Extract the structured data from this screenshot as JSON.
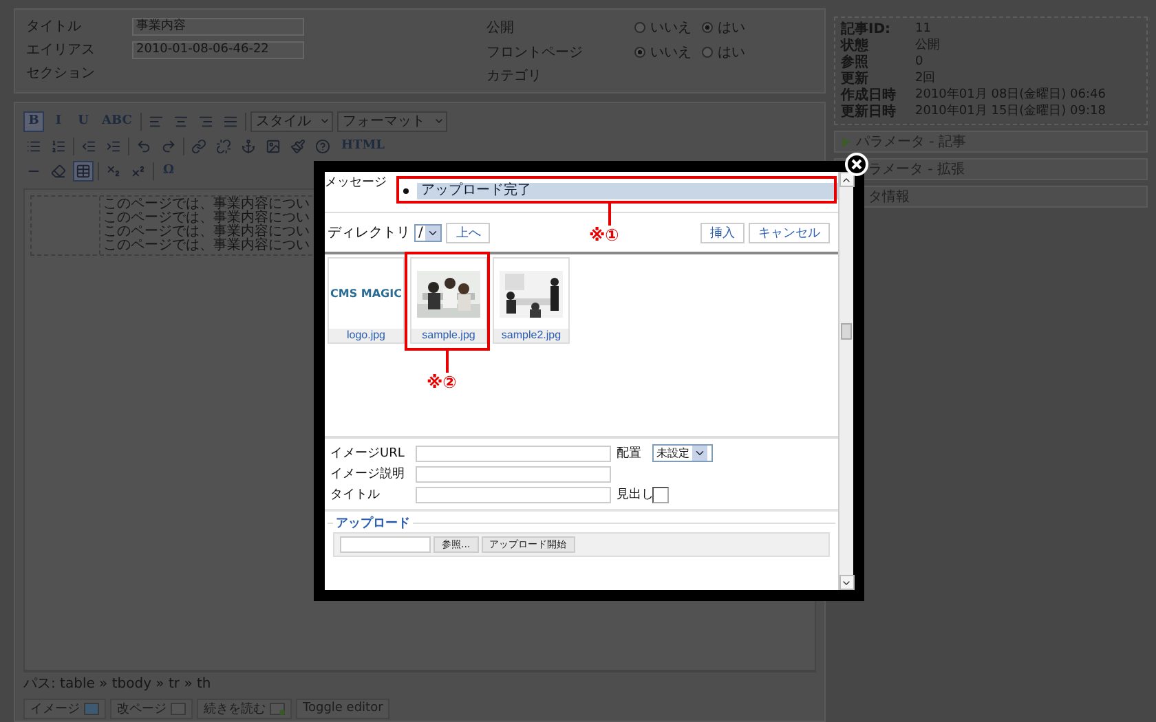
{
  "article_form": {
    "left": [
      {
        "label": "タイトル",
        "value": "事業内容"
      },
      {
        "label": "エイリアス",
        "value": "2010-01-08-06-46-22"
      },
      {
        "label": "セクション"
      }
    ],
    "right": [
      {
        "label": "公開",
        "choices": [
          {
            "label": "いいえ",
            "selected": false
          },
          {
            "label": "はい",
            "selected": true
          }
        ]
      },
      {
        "label": "フロントページ",
        "choices": [
          {
            "label": "いいえ",
            "selected": true
          },
          {
            "label": "はい",
            "selected": false
          }
        ]
      },
      {
        "label": "カテゴリ"
      }
    ]
  },
  "editor": {
    "toolbar": [
      [
        {
          "kind": "text",
          "label": "B",
          "selected": true
        },
        {
          "kind": "text",
          "label": "I",
          "selected": false
        },
        {
          "kind": "text",
          "label": "U",
          "selected": false
        },
        {
          "kind": "text",
          "label": "ABC",
          "selected": false
        },
        {
          "kind": "separator"
        },
        {
          "kind": "icon",
          "selected": false
        },
        {
          "kind": "icon",
          "selected": false
        },
        {
          "kind": "icon",
          "selected": false
        },
        {
          "kind": "icon",
          "selected": false
        },
        {
          "kind": "separator"
        },
        {
          "kind": "select",
          "label": "スタイル"
        },
        {
          "kind": "select",
          "label": "フォーマット"
        }
      ],
      [
        {
          "kind": "icon",
          "selected": false
        },
        {
          "kind": "icon",
          "selected": false
        },
        {
          "kind": "separator"
        },
        {
          "kind": "icon",
          "selected": false
        },
        {
          "kind": "icon",
          "selected": false
        },
        {
          "kind": "separator"
        },
        {
          "kind": "icon",
          "selected": false
        },
        {
          "kind": "icon",
          "selected": false
        },
        {
          "kind": "separator"
        },
        {
          "kind": "icon",
          "selected": false
        },
        {
          "kind": "icon",
          "selected": false
        },
        {
          "kind": "icon",
          "selected": false
        },
        {
          "kind": "icon",
          "selected": false
        },
        {
          "kind": "icon",
          "selected": false
        },
        {
          "kind": "icon",
          "selected": false
        },
        {
          "kind": "text",
          "label": "HTML",
          "selected": false
        }
      ],
      [
        {
          "kind": "icon",
          "selected": false
        },
        {
          "kind": "icon",
          "selected": false
        },
        {
          "kind": "icon",
          "selected": true
        },
        {
          "kind": "separator"
        },
        {
          "kind": "icon",
          "selected": false
        },
        {
          "kind": "icon",
          "selected": false
        },
        {
          "kind": "separator"
        },
        {
          "kind": "text",
          "label": "Ω",
          "selected": false
        }
      ]
    ],
    "content_lines": [
      "このページでは、事業内容につい",
      "このページでは、事業内容につい",
      "このページでは、事業内容につい",
      "このページでは、事業内容につい"
    ],
    "path": "パス: table » tbody » tr » th",
    "buttons": [
      {
        "label": "イメージ"
      },
      {
        "label": "改ページ"
      },
      {
        "label": "続きを読む"
      },
      {
        "label": "Toggle editor"
      }
    ]
  },
  "info": [
    {
      "label": "記事ID:",
      "value": "11"
    },
    {
      "label": "状態",
      "value": "公開"
    },
    {
      "label": "参照",
      "value": "0"
    },
    {
      "label": "更新",
      "value": "2回"
    },
    {
      "label": "作成日時",
      "value": "2010年01月 08日(金曜日) 06:46"
    },
    {
      "label": "更新日時",
      "value": "2010年01月 15日(金曜日) 09:18"
    }
  ],
  "panels": [
    {
      "label": "パラメータ - 記事"
    },
    {
      "label": "ラメータ - 拡張"
    },
    {
      "label": "タ情報"
    }
  ],
  "dialog": {
    "message_label": "メッセージ",
    "messages": [
      "アップロード完了"
    ],
    "directory_label": "ディレクトリ",
    "directory": "/",
    "up_button": "上へ",
    "insert_button": "挿入",
    "cancel_button": "キャンセル",
    "files": [
      {
        "name": "logo.jpg",
        "kind": "logo",
        "logo_text": "CMS MAGIC"
      },
      {
        "name": "sample.jpg",
        "kind": "picture"
      },
      {
        "name": "sample2.jpg",
        "kind": "picture"
      }
    ],
    "url_label": "イメージURL",
    "align_label": "配置",
    "align_value": "未設定",
    "description_label": "イメージ説明",
    "title_label": "タイトル",
    "heading_label": "見出し",
    "heading_checked": false,
    "upload": {
      "legend": "アップロード",
      "browse_button": "参照...",
      "start_button": "アップロード開始"
    },
    "annotations": [
      "※①",
      "※②"
    ]
  }
}
